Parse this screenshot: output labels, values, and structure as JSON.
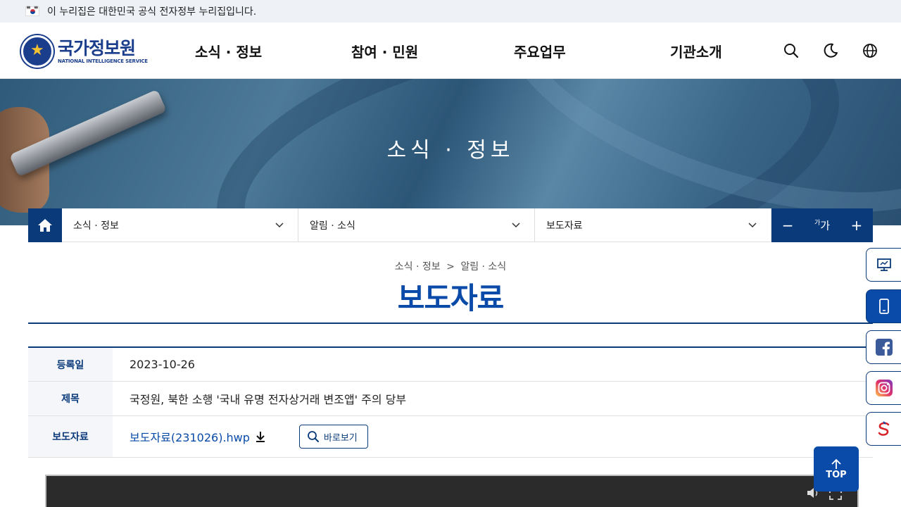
{
  "gov_banner": {
    "text": "이 누리집은 대한민국 공식 전자정부 누리집입니다."
  },
  "header": {
    "logo_ko": "국가정보원",
    "logo_en": "NATIONAL INTELLIGENCE SERVICE",
    "nav": [
      "소식 · 정보",
      "참여 · 민원",
      "주요업무",
      "기관소개"
    ],
    "icons": [
      "search-icon",
      "dark-mode-icon",
      "language-icon"
    ]
  },
  "hero": {
    "title": "소식 · 정보"
  },
  "location": {
    "depth1": "소식 · 정보",
    "depth2": "알림 · 소식",
    "depth3": "보도자료",
    "font_size": {
      "decrease": "−",
      "label_small": "가",
      "label_big": "가",
      "increase": "+"
    }
  },
  "breadcrumb": {
    "item1": "소식 · 정보",
    "separator": ">",
    "item2": "알림 · 소식"
  },
  "page_title": "보도자료",
  "info": {
    "date_label": "등록일",
    "date_value": "2023-10-26",
    "subject_label": "제목",
    "subject_value": "국정원, 북한 소행 '국내 유명 전자상거래 변조앱' 주의 당부",
    "file_label": "보도자료",
    "file_name": "보도자료(231026).hwp",
    "view_label": "바로보기"
  },
  "quick_menu": [
    "monitor-icon",
    "mobile-icon",
    "facebook-icon",
    "instagram-icon",
    "sns-icon"
  ],
  "top_button": "TOP",
  "colors": {
    "primary": "#0a3a7a",
    "accent": "#0a4aa8"
  }
}
